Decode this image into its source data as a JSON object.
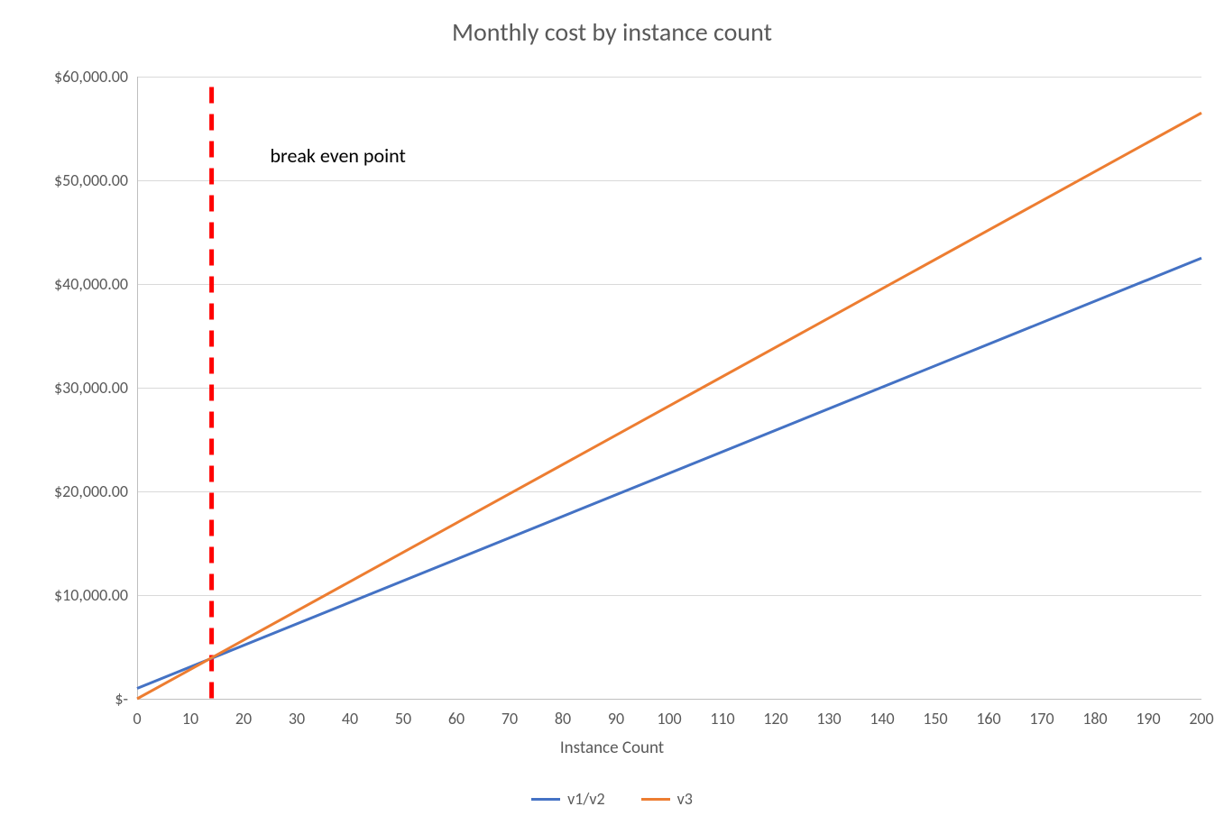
{
  "chart_data": {
    "type": "line",
    "title": "Monthly cost by instance count",
    "xlabel": "Instance Count",
    "ylabel": "",
    "xlim": [
      0,
      200
    ],
    "ylim": [
      0,
      60000
    ],
    "x_ticks": [
      0,
      10,
      20,
      30,
      40,
      50,
      60,
      70,
      80,
      90,
      100,
      110,
      120,
      130,
      140,
      150,
      160,
      170,
      180,
      190,
      200
    ],
    "y_ticks": [
      0,
      10000,
      20000,
      30000,
      40000,
      50000,
      60000
    ],
    "y_tick_labels": [
      "$-",
      "$10,000.00",
      "$20,000.00",
      "$30,000.00",
      "$40,000.00",
      "$50,000.00",
      "$60,000.00"
    ],
    "series": [
      {
        "name": "v1/v2",
        "color": "#4472c4",
        "x": [
          0,
          200
        ],
        "y": [
          1000,
          42500
        ]
      },
      {
        "name": "v3",
        "color": "#ed7d31",
        "x": [
          0,
          200
        ],
        "y": [
          0,
          56500
        ]
      }
    ],
    "annotations": [
      {
        "type": "vline",
        "x": 14,
        "color": "#ff0000",
        "dash": true,
        "y0": 0,
        "y1": 59000
      },
      {
        "type": "text",
        "text": "break even point",
        "x": 25,
        "y": 52500,
        "anchor": "left"
      }
    ],
    "legend_position": "bottom",
    "grid": {
      "y": true,
      "x": false
    }
  },
  "legend": {
    "items": [
      {
        "label": "v1/v2",
        "color": "#4472c4"
      },
      {
        "label": "v3",
        "color": "#ed7d31"
      }
    ]
  }
}
